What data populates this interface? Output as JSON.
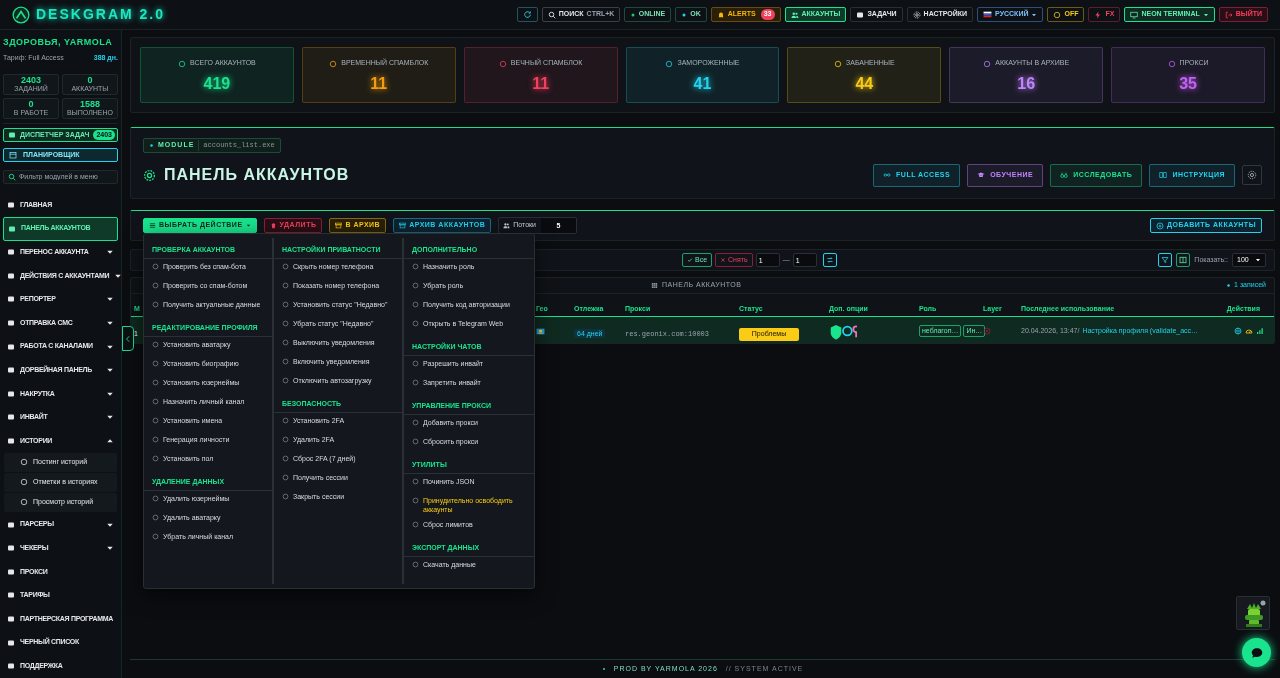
{
  "topbar": {
    "title": "DESKGRAM 2.0",
    "search": {
      "label": "ПОИСК",
      "shortcut": "CTRL+K"
    },
    "status": [
      {
        "label": "ONLINE",
        "color": "#22c55e"
      },
      {
        "label": "OK",
        "color": "#22d3ee"
      }
    ],
    "alerts": {
      "label": "ALERTS",
      "count": "33"
    },
    "nav": [
      {
        "label": "АККАУНТЫ",
        "selected": true
      },
      {
        "label": "ЗАДАЧИ",
        "selected": false
      },
      {
        "label": "НАСТРОЙКИ",
        "selected": false
      }
    ],
    "language": "РУССКИЙ",
    "toggles": [
      {
        "label": "OFF",
        "kind": "power"
      },
      {
        "label": "FX",
        "kind": "fx"
      }
    ],
    "theme": "NEON TERMINAL",
    "logout": "ВЫЙТИ"
  },
  "sidebar": {
    "greeting": "ЗДОРОВЬЯ, YARMOLA",
    "plan": "Тариф: Full Access",
    "days": "388 дн.",
    "stats": [
      {
        "value": "2403",
        "label": "ЗАДАНИЙ"
      },
      {
        "value": "0",
        "label": "АККАУНТЫ"
      },
      {
        "value": "0",
        "label": "В РАБОТЕ"
      },
      {
        "value": "1588",
        "label": "ВЫПОЛНЕНО"
      }
    ],
    "dispatcher": {
      "label": "ДИСПЕТЧЕР ЗАДАЧ",
      "badge": "2403"
    },
    "planner": "ПЛАНИРОВЩИК",
    "filter": {
      "placeholder": "Фильтр модулей в меню"
    },
    "items": [
      {
        "label": "ГЛАВНАЯ",
        "selected": false
      },
      {
        "label": "ПАНЕЛЬ АККАУНТОВ",
        "selected": true
      },
      {
        "label": "ПЕРЕНОС АККАУНТА",
        "selected": false,
        "expanded": false
      },
      {
        "label": "ДЕЙСТВИЯ С АККАУНТАМИ",
        "selected": false,
        "expanded": false
      },
      {
        "label": "РЕПОРТЕР",
        "selected": false,
        "expanded": false
      },
      {
        "label": "ОТПРАВКА СМС",
        "selected": false,
        "expanded": false
      },
      {
        "label": "РАБОТА С КАНАЛАМИ",
        "selected": false,
        "expanded": false
      },
      {
        "label": "ДОРВЕЙНАЯ ПАНЕЛЬ",
        "selected": false,
        "expanded": false
      },
      {
        "label": "НАКРУТКА",
        "selected": false,
        "expanded": false
      },
      {
        "label": "ИНВАЙТ",
        "selected": false,
        "expanded": false
      },
      {
        "label": "ИСТОРИИ",
        "selected": false,
        "expanded": true,
        "children": [
          {
            "label": "Постинг историй",
            "selected": false
          },
          {
            "label": "Отметки в историях",
            "selected": false
          },
          {
            "label": "Просмотр историй",
            "selected": false
          }
        ]
      },
      {
        "label": "ПАРСЕРЫ",
        "selected": false,
        "expanded": false
      },
      {
        "label": "ЧЕКЕРЫ",
        "selected": false,
        "expanded": false
      },
      {
        "label": "ПРОКСИ",
        "selected": false
      },
      {
        "label": "ТАРИФЫ",
        "selected": false
      },
      {
        "label": "ПАРТНЕРСКАЯ ПРОГРАММА",
        "selected": false
      },
      {
        "label": "ЧЕРНЫЙ СПИСОК",
        "selected": false
      },
      {
        "label": "ПОДДЕРЖКА",
        "selected": false
      }
    ]
  },
  "stat_cards": [
    {
      "label": "ВСЕГО АККАУНТОВ",
      "value": "419",
      "color": "#19e38d"
    },
    {
      "label": "ВРЕМЕННЫЙ СПАМБЛОК",
      "value": "11",
      "color": "#f59e0b"
    },
    {
      "label": "ВЕЧНЫЙ СПАМБЛОК",
      "value": "11",
      "color": "#f43f5e"
    },
    {
      "label": "ЗАМОРОЖЕННЫЕ",
      "value": "41",
      "color": "#22d3ee"
    },
    {
      "label": "ЗАБАНЕННЫЕ",
      "value": "44",
      "color": "#facc15"
    },
    {
      "label": "АККАУНТЫ В АРХИВЕ",
      "value": "16",
      "color": "#c084fc"
    },
    {
      "label": "ПРОКСИ",
      "value": "35",
      "color": "#c561f5"
    }
  ],
  "panel": {
    "module": "MODULE",
    "file": "accounts_list.exe",
    "title": "ПАНЕЛЬ АККАУНТОВ",
    "buttons": [
      {
        "label": "FULL ACCESS",
        "color": "#22d3ee"
      },
      {
        "label": "ОБУЧЕНИЕ",
        "color": "#c084fc"
      },
      {
        "label": "ИССЛЕДОВАТЬ",
        "color": "#19e38d"
      },
      {
        "label": "ИНСТРУКЦИЯ",
        "color": "#22d3ee"
      }
    ]
  },
  "toolbar": {
    "choose": "ВЫБРАТЬ ДЕЙСТВИЕ",
    "delete": "УДАЛИТЬ",
    "archive": "В АРХИВ",
    "archive_list": "АРХИВ АККАУНТОВ",
    "threads_label": "Потоки",
    "threads": "5",
    "add": "ДОБАВИТЬ АККАУНТЫ"
  },
  "selection": {
    "all": "Все",
    "clear": "Снять",
    "from": "1",
    "dash": "—",
    "to": "1",
    "show_label": "Показать::",
    "show": "100"
  },
  "table": {
    "caption": "ПАНЕЛЬ АККАУНТОВ",
    "count": "1 записей",
    "columns": [
      "М",
      "Гео",
      "Отлежка",
      "Прокси",
      "Статус",
      "Доп. опции",
      "Роль",
      "Layer",
      "Последнее использование",
      "Действия"
    ],
    "rows": [
      {
        "selected": true,
        "number": "1",
        "age": "64 дней",
        "proxy": "res.geonix.com:10003",
        "status": "Проблемы",
        "roles": [
          "неблагоп…",
          "Ин…"
        ],
        "last_used": "20.04.2026, 13:47/",
        "last_action": "Настройка профиля (validate_acc…"
      }
    ]
  },
  "menu": {
    "columns": [
      [
        {
          "title": "ПРОВЕРКА АККАУНТОВ",
          "items": [
            {
              "label": "Проверить без спам-бота",
              "kind": "action"
            },
            {
              "label": "Проверить со спам-ботом",
              "kind": "action"
            },
            {
              "label": "Получить актуальные данные",
              "kind": "action"
            }
          ]
        },
        {
          "title": "РЕДАКТИРОВАНИЕ ПРОФИЛЯ",
          "items": [
            {
              "label": "Установить аватарку",
              "kind": "action"
            },
            {
              "label": "Установить биографию",
              "kind": "action"
            },
            {
              "label": "Установить юзернеймы",
              "kind": "action"
            },
            {
              "label": "Назначить личный канал",
              "kind": "action"
            },
            {
              "label": "Установить имена",
              "kind": "action"
            },
            {
              "label": "Генерация личности",
              "kind": "action"
            },
            {
              "label": "Установить пол",
              "kind": "action"
            }
          ]
        },
        {
          "title": "УДАЛЕНИЕ ДАННЫХ",
          "items": [
            {
              "label": "Удалить юзернеймы",
              "kind": "action"
            },
            {
              "label": "Удалить аватарку",
              "kind": "action"
            },
            {
              "label": "Убрать личный канал",
              "kind": "action"
            }
          ]
        }
      ],
      [
        {
          "title": "НАСТРОЙКИ ПРИВАТНОСТИ",
          "items": [
            {
              "label": "Скрыть номер телефона",
              "kind": "action"
            },
            {
              "label": "Показать номер телефона",
              "kind": "action"
            },
            {
              "label": "Установить статус \"Недавно\"",
              "kind": "action"
            },
            {
              "label": "Убрать статус \"Недавно\"",
              "kind": "action"
            },
            {
              "label": "Выключить уведомления",
              "kind": "action"
            },
            {
              "label": "Включить уведомления",
              "kind": "action"
            },
            {
              "label": "Отключить автозагрузку",
              "kind": "action"
            }
          ]
        },
        {
          "title": "БЕЗОПАСНОСТЬ",
          "items": [
            {
              "label": "Установить 2FA",
              "kind": "action"
            },
            {
              "label": "Удалить 2FA",
              "kind": "action"
            },
            {
              "label": "Сброс 2FA (7 дней)",
              "kind": "action"
            },
            {
              "label": "Получить сессии",
              "kind": "action"
            },
            {
              "label": "Закрыть сессии",
              "kind": "action"
            }
          ]
        }
      ],
      [
        {
          "title": "ДОПОЛНИТЕЛЬНО",
          "items": [
            {
              "label": "Назначить роль",
              "kind": "action"
            },
            {
              "label": "Убрать роль",
              "kind": "action"
            },
            {
              "label": "Получить код авторизации",
              "kind": "action"
            },
            {
              "label": "Открыть в Telegram Web",
              "kind": "action"
            }
          ]
        },
        {
          "title": "НАСТРОЙКИ ЧАТОВ",
          "items": [
            {
              "label": "Разрешить инвайт",
              "kind": "action"
            },
            {
              "label": "Запретить инвайт",
              "kind": "action"
            }
          ]
        },
        {
          "title": "УПРАВЛЕНИЕ ПРОКСИ",
          "items": [
            {
              "label": "Добавить прокси",
              "kind": "action"
            },
            {
              "label": "Сбросить прокси",
              "kind": "action"
            }
          ]
        },
        {
          "title": "УТИЛИТЫ",
          "items": [
            {
              "label": "Починить JSON",
              "kind": "action"
            },
            {
              "label": "Принудительно освободить аккаунты",
              "kind": "warning"
            },
            {
              "label": "Сброс лимитов",
              "kind": "action"
            }
          ]
        },
        {
          "title": "ЭКСПОРТ ДАННЫХ",
          "items": [
            {
              "label": "Скачать данные",
              "kind": "action"
            }
          ]
        }
      ]
    ]
  },
  "footer": {
    "credit": "PROD BY YARMOLA 2026",
    "status": "// SYSTEM ACTIVE"
  }
}
